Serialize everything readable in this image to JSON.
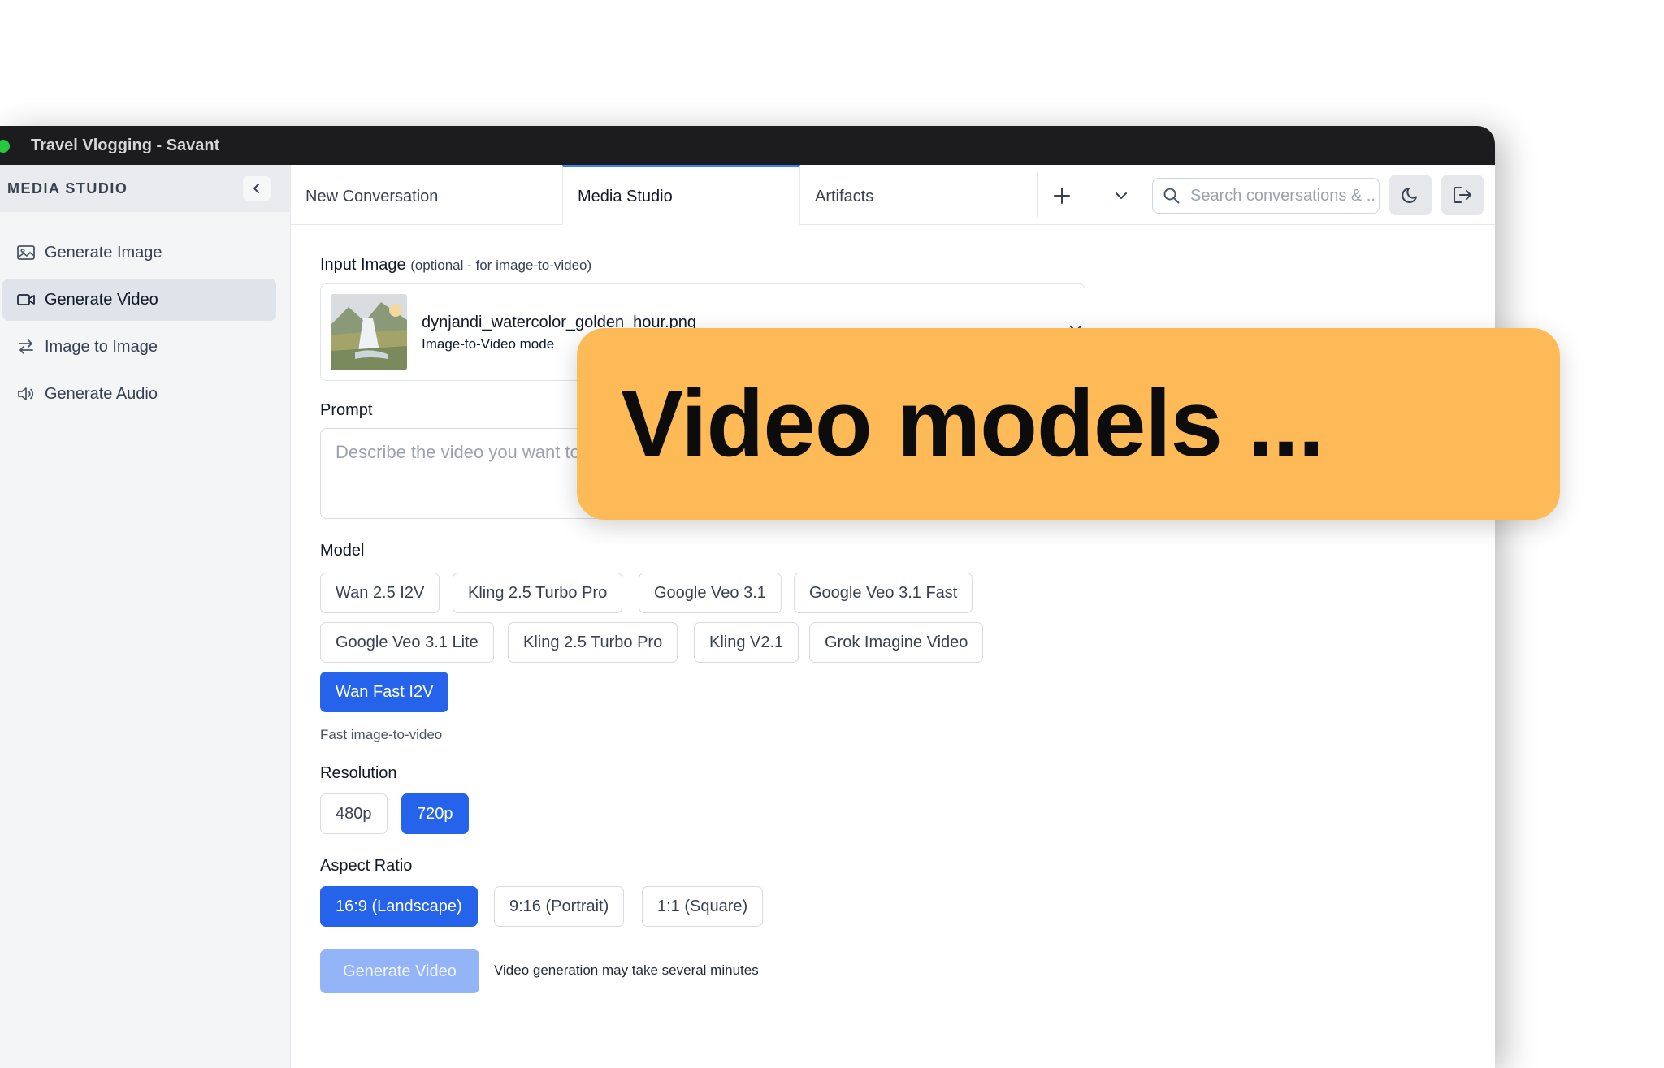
{
  "window": {
    "title": "Travel Vlogging - Savant"
  },
  "sidebar": {
    "title": "MEDIA STUDIO",
    "items": [
      {
        "label": "Generate Image",
        "icon": "image-icon",
        "active": false
      },
      {
        "label": "Generate Video",
        "icon": "video-icon",
        "active": true
      },
      {
        "label": "Image to Image",
        "icon": "swap-arrows-icon",
        "active": false
      },
      {
        "label": "Generate Audio",
        "icon": "speaker-icon",
        "active": false
      }
    ]
  },
  "tabs": [
    {
      "label": "New Conversation",
      "active": false
    },
    {
      "label": "Media Studio",
      "active": true
    },
    {
      "label": "Artifacts",
      "active": false
    }
  ],
  "search": {
    "placeholder": "Search conversations & ..."
  },
  "input_image": {
    "label": "Input Image",
    "label_note": "(optional - for image-to-video)",
    "file_name": "dynjandi_watercolor_golden_hour.png",
    "mode": "Image-to-Video mode"
  },
  "prompt": {
    "label": "Prompt",
    "placeholder": "Describe the video you want to generate..."
  },
  "model": {
    "label": "Model",
    "options": [
      "Wan 2.5 I2V",
      "Kling 2.5 Turbo Pro",
      "Google Veo 3.1",
      "Google Veo 3.1 Fast",
      "Google Veo 3.1 Lite",
      "Kling 2.5 Turbo Pro",
      "Kling V2.1",
      "Grok Imagine Video",
      "Wan Fast I2V"
    ],
    "selected": "Wan Fast I2V",
    "description": "Fast image-to-video"
  },
  "resolution": {
    "label": "Resolution",
    "options": [
      "480p",
      "720p"
    ],
    "selected": "720p"
  },
  "aspect_ratio": {
    "label": "Aspect Ratio",
    "options": [
      "16:9 (Landscape)",
      "9:16 (Portrait)",
      "1:1 (Square)"
    ],
    "selected": "16:9 (Landscape)"
  },
  "generate": {
    "label": "Generate Video",
    "note": "Video generation may take several minutes"
  },
  "banner": {
    "text": "Video models ..."
  },
  "colors": {
    "accent": "#2563eb",
    "banner": "#fdba56",
    "titlebar": "#1c1c1e"
  }
}
